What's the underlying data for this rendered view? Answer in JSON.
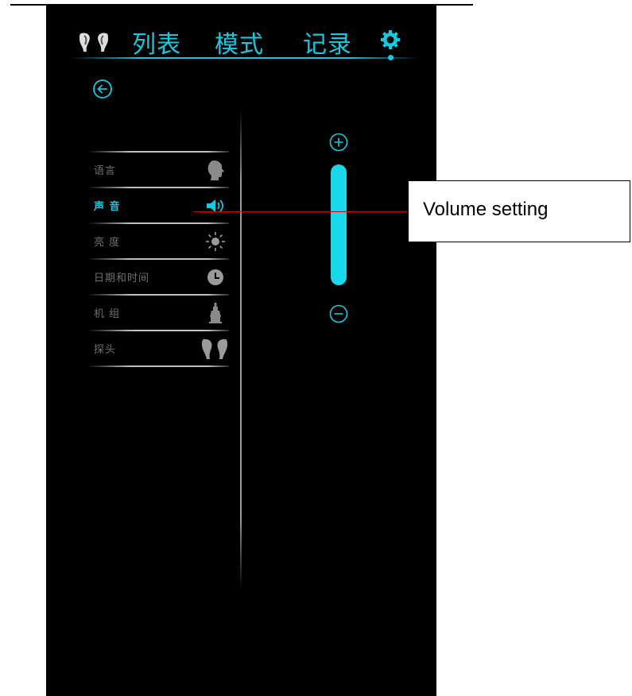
{
  "header": {
    "tabs": [
      {
        "label": "列表"
      },
      {
        "label": "模式"
      },
      {
        "label": "记录"
      }
    ],
    "icons": {
      "left": "earbuds-icon",
      "right": "gear-icon"
    },
    "accent_color": "#19c8df"
  },
  "back_icon": "back-arrow-icon",
  "menu": {
    "items": [
      {
        "label": "语言",
        "icon": "head-icon",
        "active": false
      },
      {
        "label": "声 音",
        "icon": "speaker-icon",
        "active": true
      },
      {
        "label": "亮 度",
        "icon": "sun-icon",
        "active": false
      },
      {
        "label": "日期和时间",
        "icon": "clock-icon",
        "active": false
      },
      {
        "label": "机 组",
        "icon": "unit-icon",
        "active": false
      },
      {
        "label": "探头",
        "icon": "probe-icon",
        "active": false
      }
    ]
  },
  "volume": {
    "plus_icon": "plus-circle-icon",
    "minus_icon": "minus-circle-icon",
    "bar_color": "#19d8ec"
  },
  "callout": {
    "text": "Volume setting",
    "line_color": "#cc0000"
  }
}
